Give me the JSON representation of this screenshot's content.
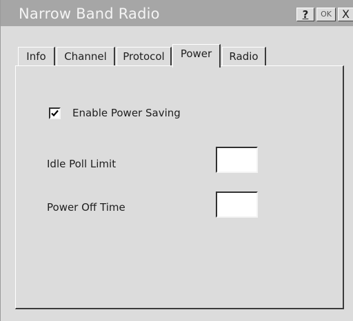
{
  "window": {
    "title": "Narrow Band Radio"
  },
  "titlebar_buttons": {
    "help": "?",
    "ok": "OK",
    "close": "X"
  },
  "tabs": [
    {
      "label": "Info",
      "active": false
    },
    {
      "label": "Channel",
      "active": false
    },
    {
      "label": "Protocol",
      "active": false
    },
    {
      "label": "Power",
      "active": true
    },
    {
      "label": "Radio",
      "active": false
    }
  ],
  "power": {
    "enable_power_saving": {
      "label": "Enable Power Saving",
      "checked": true
    },
    "idle_poll_limit": {
      "label": "Idle Poll Limit",
      "value": ""
    },
    "power_off_time": {
      "label": "Power Off Time",
      "value": ""
    }
  }
}
